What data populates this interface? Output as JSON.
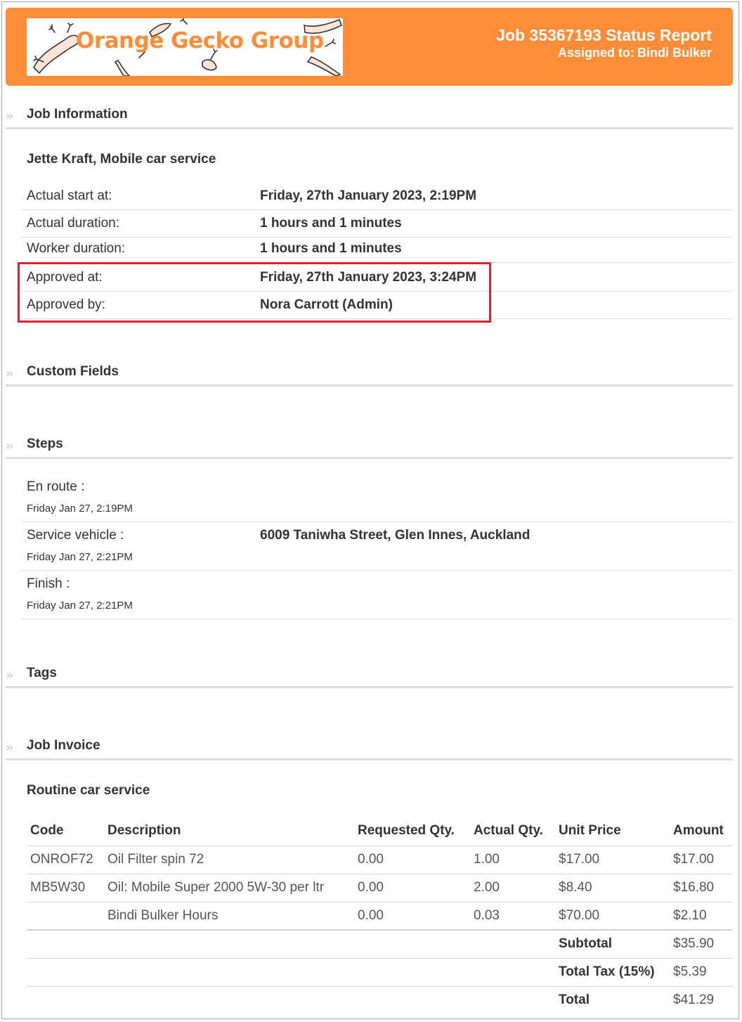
{
  "header": {
    "company": "Orange Gecko Group",
    "title": "Job 35367193 Status Report",
    "assigned_label": "Assigned to:",
    "assigned_name": "Bindi Bulker",
    "brand_color": "#ff8c37"
  },
  "sections": {
    "job_information": "Job Information",
    "custom_fields": "Custom Fields",
    "steps": "Steps",
    "tags": "Tags",
    "job_invoice": "Job Invoice"
  },
  "job": {
    "client": "Jette Kraft, Mobile car service",
    "rows": [
      {
        "label": "Actual start at:",
        "value": "Friday, 27th January 2023, 2:19PM"
      },
      {
        "label": "Actual duration:",
        "value": "1 hours and 1 minutes"
      },
      {
        "label": "Worker duration:",
        "value": "1 hours and 1 minutes"
      },
      {
        "label": "Approved at:",
        "value": "Friday, 27th January 2023, 3:24PM"
      },
      {
        "label": "Approved by:",
        "value": "Nora Carrott (Admin)"
      }
    ]
  },
  "steps": [
    {
      "label": "En route :",
      "time": "Friday Jan 27, 2:19PM",
      "value": ""
    },
    {
      "label": "Service vehicle :",
      "time": "Friday Jan 27, 2:21PM",
      "value": "6009 Taniwha Street, Glen Innes, Auckland"
    },
    {
      "label": "Finish :",
      "time": "Friday Jan 27, 2:21PM",
      "value": ""
    }
  ],
  "invoice": {
    "title": "Routine car service",
    "columns": [
      "Code",
      "Description",
      "Requested Qty.",
      "Actual Qty.",
      "Unit Price",
      "Amount"
    ],
    "items": [
      {
        "code": "ONROF72",
        "description": "Oil Filter spin 72",
        "requested": "0.00",
        "actual": "1.00",
        "unit_price": "$17.00",
        "amount": "$17.00"
      },
      {
        "code": "MB5W30",
        "description": "Oil: Mobile Super 2000 5W-30 per ltr",
        "requested": "0.00",
        "actual": "2.00",
        "unit_price": "$8.40",
        "amount": "$16.80"
      },
      {
        "code": "",
        "description": "Bindi Bulker Hours",
        "requested": "0.00",
        "actual": "0.03",
        "unit_price": "$70.00",
        "amount": "$2.10"
      }
    ],
    "subtotal_label": "Subtotal",
    "subtotal": "$35.90",
    "tax_label": "Total Tax (15%)",
    "tax": "$5.39",
    "total_label": "Total",
    "total": "$41.29"
  },
  "highlight_color": "#e0202a"
}
